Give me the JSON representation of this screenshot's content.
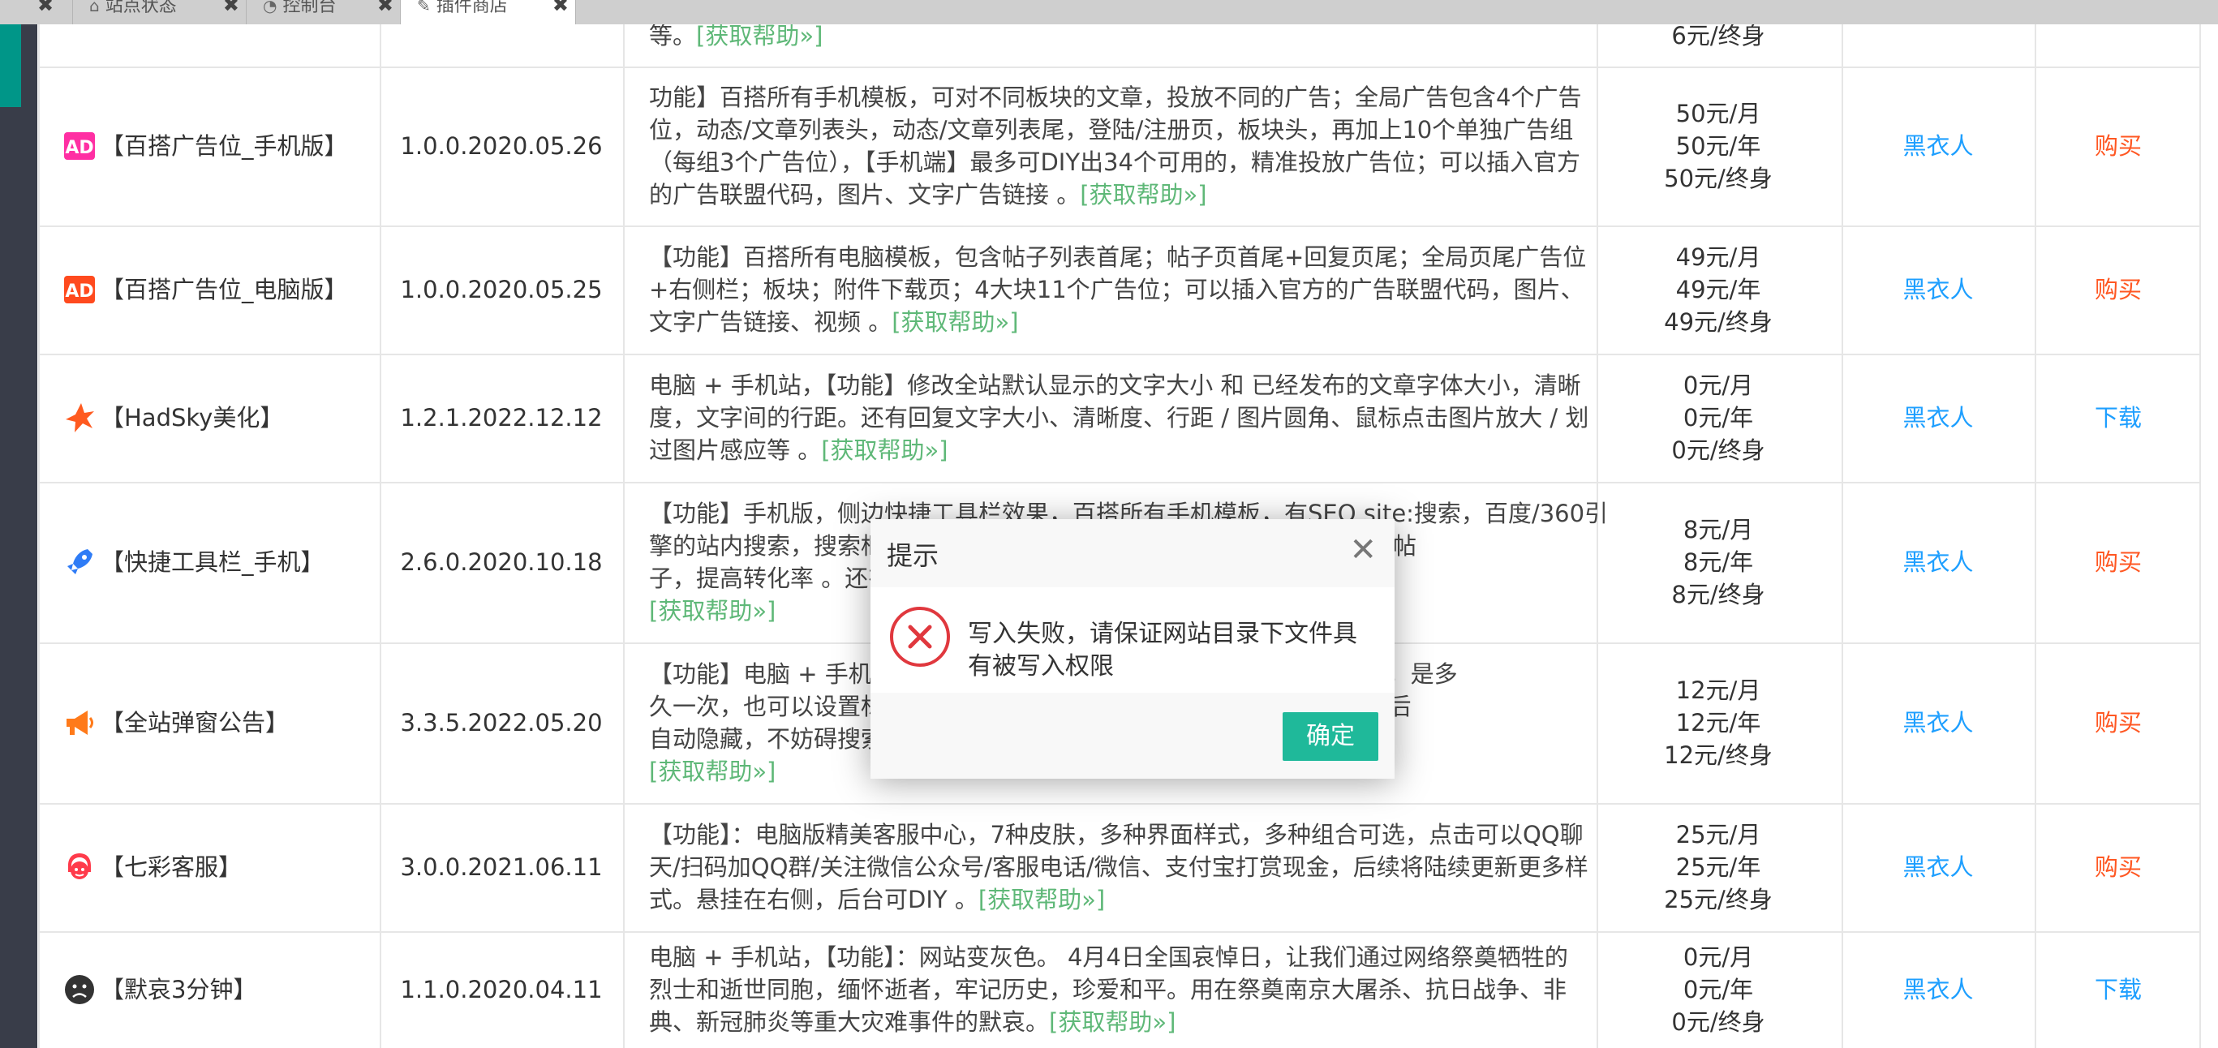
{
  "tabs": [
    {
      "label": "站点状态",
      "icon": "home-icon"
    },
    {
      "label": "控制台",
      "icon": "dashboard-icon"
    },
    {
      "label": "插件商店",
      "icon": "plugin-icon"
    }
  ],
  "top_partial_row": {
    "desc_tail": "等。",
    "help": "[获取帮助»]",
    "price": "6元/终身"
  },
  "rows": [
    {
      "name": "【百搭广告位_手机版】",
      "icon": "ad-mobile-icon",
      "icon_color": "#ff2fa3",
      "version": "1.0.0.2020.05.26",
      "desc_lines": [
        "功能】百搭所有手机模板，可对不同板块的文章，投放不同的广告；全局广告包含4个广告",
        "位，动态/文章列表头，动态/文章列表尾，登陆/注册页，板块头，再加上10个单独广告组",
        "（每组3个广告位），【手机端】最多可DIY出34个可用的，精准投放广告位；可以插入官方",
        "的广告联盟代码，图片、文字广告链接 。"
      ],
      "help": "[获取帮助»]",
      "prices": [
        "50元/月",
        "50元/年",
        "50元/终身"
      ],
      "author": "黑衣人",
      "action": "购买",
      "action_type": "buy"
    },
    {
      "name": "【百搭广告位_电脑版】",
      "icon": "ad-pc-icon",
      "icon_color": "#ff4a1e",
      "version": "1.0.0.2020.05.25",
      "desc_lines": [
        "【功能】百搭所有电脑模板，包含帖子列表首尾；帖子页首尾+回复页尾；全局页尾广告位",
        "+右侧栏；板块；附件下载页；4大块11个广告位；可以插入官方的广告联盟代码，图片、",
        "文字广告链接、视频 。"
      ],
      "help": "[获取帮助»]",
      "prices": [
        "49元/月",
        "49元/年",
        "49元/终身"
      ],
      "author": "黑衣人",
      "action": "购买",
      "action_type": "buy"
    },
    {
      "name": "【HadSky美化】",
      "icon": "star-splash-icon",
      "icon_color": "#ff5a1f",
      "version": "1.2.1.2022.12.12",
      "desc_lines": [
        "电脑 + 手机站，【功能】修改全站默认显示的文字大小 和 已经发布的文章字体大小，清晰",
        "度，文字间的行距。还有回复文字大小、清晰度、行距 / 图片圆角、鼠标点击图片放大 / 划",
        "过图片感应等 。"
      ],
      "help": "[获取帮助»]",
      "prices": [
        "0元/月",
        "0元/年",
        "0元/终身"
      ],
      "author": "黑衣人",
      "action": "下载",
      "action_type": "download"
    },
    {
      "name": "【快捷工具栏_手机】",
      "icon": "rocket-icon",
      "icon_color": "#2f7cf6",
      "version": "2.6.0.2020.10.18",
      "desc_lines": [
        "【功能】手机版，侧边快捷工具栏效果，百搭所有手机模板，有SEO site:搜索，百度/360引",
        "擎的站内搜索，搜索框，                                              站点内的所有帖",
        "子，提高转化率 。还有                                              侧边快捷功能 。"
      ],
      "help": "[获取帮助»]",
      "help_newline": true,
      "prices": [
        "8元/月",
        "8元/年",
        "8元/终身"
      ],
      "author": "黑衣人",
      "action": "购买",
      "action_type": "buy"
    },
    {
      "name": "【全站弹窗公告】",
      "icon": "megaphone-icon",
      "icon_color": "#ff7a1a",
      "version": "3.3.5.2022.05.20",
      "desc_lines": [
        "【功能】电脑 + 手机站                                                  出公告时间，是多",
        "久一次，也可以设置标                                              链接。。30秒钟后",
        "自动隐藏，不妨碍搜索                                              l/只启用手机 。"
      ],
      "help": "[获取帮助»]",
      "help_newline": true,
      "prices": [
        "12元/月",
        "12元/年",
        "12元/终身"
      ],
      "author": "黑衣人",
      "action": "购买",
      "action_type": "buy"
    },
    {
      "name": "【七彩客服】",
      "icon": "customer-service-icon",
      "icon_color": "#ff3b4b",
      "version": "3.0.0.2021.06.11",
      "desc_lines": [
        "【功能】：电脑版精美客服中心，7种皮肤，多种界面样式，多种组合可选，点击可以QQ聊",
        "天/扫码加QQ群/关注微信公众号/客服电话/微信、支付宝打赏现金，后续将陆续更新更多样",
        "式。悬挂在右侧，后台可DIY 。"
      ],
      "help": "[获取帮助»]",
      "prices": [
        "25元/月",
        "25元/年",
        "25元/终身"
      ],
      "author": "黑衣人",
      "action": "购买",
      "action_type": "buy"
    },
    {
      "name": "【默哀3分钟】",
      "icon": "sad-face-icon",
      "icon_color": "#333333",
      "version": "1.1.0.2020.04.11",
      "desc_lines": [
        "电脑 + 手机站，【功能】：网站变灰色。 4月4日全国哀悼日，让我们通过网络祭奠牺牲的",
        "烈士和逝世同胞，缅怀逝者，牢记历史，珍爱和平。用在祭奠南京大屠杀、抗日战争、非",
        "典、新冠肺炎等重大灾难事件的默哀。"
      ],
      "help": "[获取帮助»]",
      "prices": [
        "0元/月",
        "0元/年",
        "0元/终身"
      ],
      "author": "黑衣人",
      "action": "下载",
      "action_type": "download"
    }
  ],
  "dialog": {
    "title": "提示",
    "message": "写入失败，请保证网站目录下文件具有被写入权限",
    "ok": "确定",
    "error_color": "#e0383e",
    "button_color": "#1fb99a"
  }
}
